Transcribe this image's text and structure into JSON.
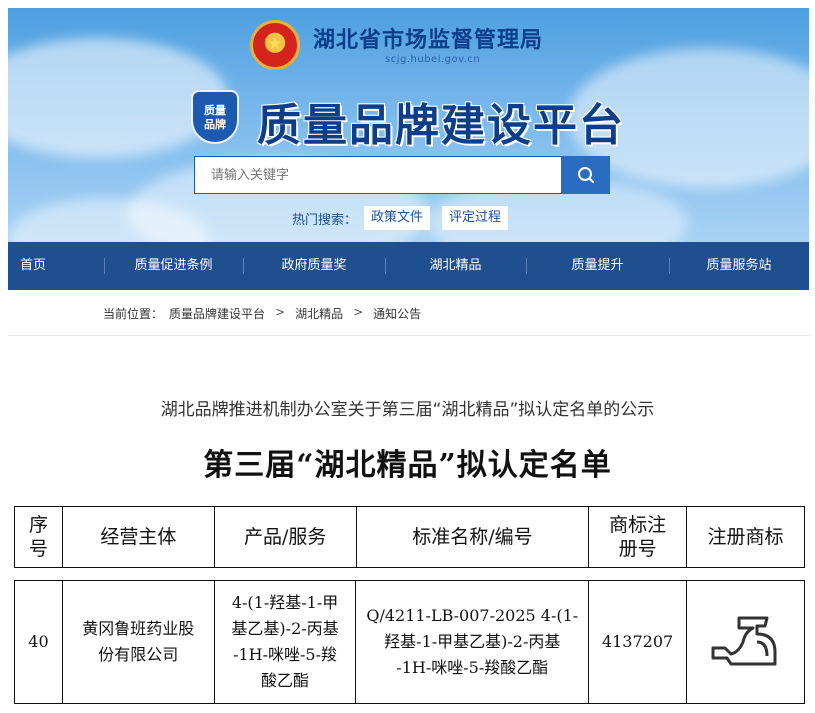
{
  "header": {
    "dept_title": "湖北省市场监督管理局",
    "dept_url": "scjg.hubei.gov.cn",
    "emblem_icon": "national-emblem-icon",
    "badge_text_line1": "质量",
    "badge_text_line2": "品牌",
    "platform_title": "质量品牌建设平台"
  },
  "search": {
    "placeholder": "请输入关键字",
    "button_icon": "search-icon",
    "hot_label": "热门搜索：",
    "hot_tags": [
      "政策文件",
      "评定过程"
    ]
  },
  "nav": {
    "items": [
      "首页",
      "质量促进条例",
      "政府质量奖",
      "湖北精品",
      "质量提升",
      "质量服务站"
    ]
  },
  "breadcrumb": {
    "label": "当前位置：",
    "items": [
      "质量品牌建设平台",
      "湖北精品",
      "通知公告"
    ],
    "separator": ">"
  },
  "article": {
    "title": "湖北品牌推进机制办公室关于第三届“湖北精品”拟认定名单的公示",
    "doc_title": "第三届“湖北精品”拟认定名单"
  },
  "table": {
    "headers": {
      "index": [
        "序",
        "号"
      ],
      "entity": "经营主体",
      "product": "产品/服务",
      "standard": "标准名称/编号",
      "reg_no": [
        "商标注",
        "册号"
      ],
      "trademark": "注册商标"
    },
    "rows": [
      {
        "index": "40",
        "entity": [
          "黄冈鲁班药业股",
          "份有限公司"
        ],
        "product": [
          "4-(1-羟基-1-甲",
          "基乙基)-2-丙基",
          "-1H-咪唑-5-羧",
          "酸乙酯"
        ],
        "standard": [
          "Q/4211-LB-007-2025 4-(1-",
          "羟基-1-甲基乙基)-2-丙基",
          "-1H-咪唑-5-羧酸乙酯"
        ],
        "reg_no": "4137207",
        "trademark_icon": "trademark-logo-icon"
      }
    ]
  },
  "colors": {
    "nav_bg": "#1f4f8f",
    "title_blue": "#0d3e8a",
    "search_btn": "#2a6cc0"
  }
}
